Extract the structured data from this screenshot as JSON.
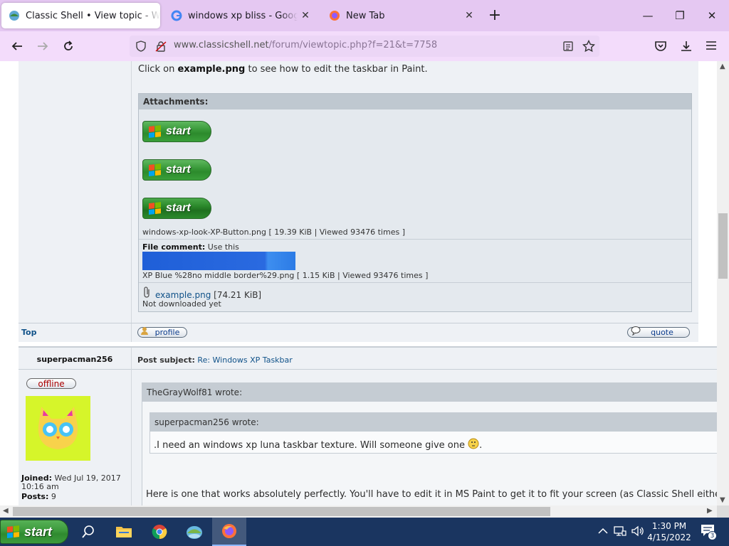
{
  "browser": {
    "tabs": [
      {
        "title": "Classic Shell • View topic - Windows XP Taskbar",
        "favicon": "classic-shell-icon",
        "active": true
      },
      {
        "title": "windows xp bliss - Google Search",
        "favicon": "google-icon",
        "active": false
      },
      {
        "title": "New Tab",
        "favicon": "firefox-icon",
        "active": false
      }
    ],
    "url_host": "www.classicshell.net",
    "url_path": "/forum/viewtopic.php?f=21&t=7758"
  },
  "post1": {
    "intro_prefix": "Click on ",
    "intro_file": "example.png",
    "intro_suffix": " to see how to edit the taskbar in Paint.",
    "attachments_label": "Attachments:",
    "start_label": "start",
    "file1_info": "windows-xp-look-XP-Button.png [ 19.39 KiB | Viewed 93476 times ]",
    "file_comment_label": "File comment:",
    "file_comment": "Use this",
    "file2_info": "XP Blue %28no middle border%29.png [ 1.15 KiB | Viewed 93476 times ]",
    "file3_name": "example.png",
    "file3_size": "[74.21 KiB]",
    "file3_status": "Not downloaded yet",
    "top_link": "Top",
    "profile_btn": "profile",
    "quote_btn": "quote"
  },
  "post2": {
    "author": "superpacman256",
    "subject_label": "Post subject:",
    "subject": "Re: Windows XP Taskbar",
    "status": "offline",
    "joined_label": "Joined:",
    "joined_value": "Wed Jul 19, 2017 10:16 am",
    "posts_label": "Posts:",
    "posts_value": "9",
    "quote_outer_author": "TheGrayWolf81 wrote:",
    "quote_inner_author": "superpacman256 wrote:",
    "quote_inner_text": ".I need an windows xp luna taskbar texture. Will someone give one",
    "quote_inner_end": ".",
    "reply_text": "Here is one that works absolutely perfectly. You'll have to edit it in MS Paint to get it to fit your screen (as Classic Shell either tiles it (you"
  },
  "taskbar": {
    "start_label": "start",
    "time": "1:30 PM",
    "date": "4/15/2022",
    "notification_count": "3"
  },
  "colors": {
    "tabstrip": "#e5c8f2",
    "navbar": "#f3dcfb",
    "taskbar": "#1a3560",
    "xp_green": "#3a9a3a",
    "link": "#105289"
  }
}
